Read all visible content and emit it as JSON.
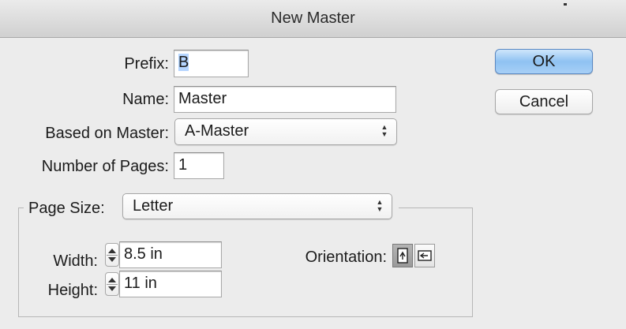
{
  "window": {
    "title": "New Master"
  },
  "form": {
    "prefix": {
      "label": "Prefix:",
      "value": "B"
    },
    "name": {
      "label": "Name:",
      "value": "Master"
    },
    "based_on": {
      "label": "Based on Master:",
      "value": "A-Master"
    },
    "num_pages": {
      "label": "Number of Pages:",
      "value": "1"
    }
  },
  "page_size": {
    "label": "Page Size:",
    "value": "Letter",
    "width": {
      "label": "Width:",
      "value": "8.5 in"
    },
    "height": {
      "label": "Height:",
      "value": "11 in"
    },
    "orientation": {
      "label": "Orientation:",
      "options": [
        "portrait",
        "landscape"
      ],
      "selected": "portrait"
    }
  },
  "buttons": {
    "ok": "OK",
    "cancel": "Cancel"
  },
  "icons": {
    "popup": "up-down-arrows-icon",
    "stepper": "stepper-arrows-icon",
    "portrait": "portrait-page-icon",
    "landscape": "landscape-page-icon"
  },
  "colors": {
    "default_button": "#8fc2f2",
    "selection": "#b5d5ff"
  }
}
